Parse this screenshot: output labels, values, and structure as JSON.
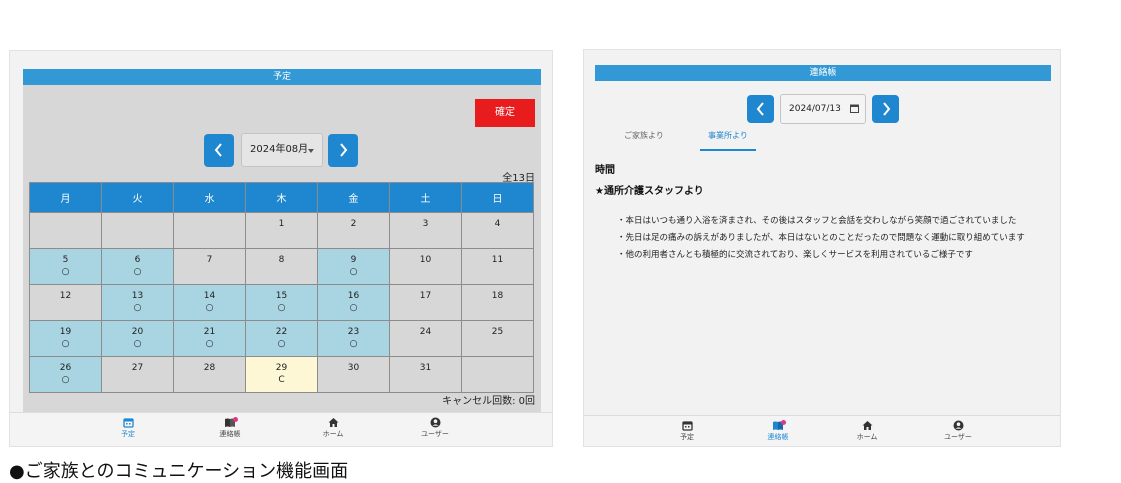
{
  "schedule": {
    "title": "予定",
    "confirm_label": "確定",
    "month_value": "2024年08月",
    "total_days": "全13日",
    "weekdays": [
      "月",
      "火",
      "水",
      "木",
      "金",
      "土",
      "日"
    ],
    "weeks": [
      [
        {
          "day": "",
          "mark": ""
        },
        {
          "day": "",
          "mark": ""
        },
        {
          "day": "",
          "mark": ""
        },
        {
          "day": "1",
          "mark": ""
        },
        {
          "day": "2",
          "mark": ""
        },
        {
          "day": "3",
          "mark": ""
        },
        {
          "day": "4",
          "mark": ""
        }
      ],
      [
        {
          "day": "5",
          "mark": "○"
        },
        {
          "day": "6",
          "mark": "○"
        },
        {
          "day": "7",
          "mark": ""
        },
        {
          "day": "8",
          "mark": ""
        },
        {
          "day": "9",
          "mark": "○"
        },
        {
          "day": "10",
          "mark": ""
        },
        {
          "day": "11",
          "mark": ""
        }
      ],
      [
        {
          "day": "12",
          "mark": ""
        },
        {
          "day": "13",
          "mark": "○"
        },
        {
          "day": "14",
          "mark": "○"
        },
        {
          "day": "15",
          "mark": "○"
        },
        {
          "day": "16",
          "mark": "○"
        },
        {
          "day": "17",
          "mark": ""
        },
        {
          "day": "18",
          "mark": ""
        }
      ],
      [
        {
          "day": "19",
          "mark": "○"
        },
        {
          "day": "20",
          "mark": "○"
        },
        {
          "day": "21",
          "mark": "○"
        },
        {
          "day": "22",
          "mark": "○"
        },
        {
          "day": "23",
          "mark": "○"
        },
        {
          "day": "24",
          "mark": ""
        },
        {
          "day": "25",
          "mark": ""
        }
      ],
      [
        {
          "day": "26",
          "mark": "○"
        },
        {
          "day": "27",
          "mark": ""
        },
        {
          "day": "28",
          "mark": ""
        },
        {
          "day": "29",
          "mark": "C"
        },
        {
          "day": "30",
          "mark": ""
        },
        {
          "day": "31",
          "mark": ""
        },
        {
          "day": "",
          "mark": ""
        }
      ]
    ],
    "cancel_count": "キャンセル回数: 0回"
  },
  "contact_book": {
    "title": "連絡帳",
    "date_value": "2024/07/13",
    "tabs": [
      {
        "label": "ご家族より",
        "active": false
      },
      {
        "label": "事業所より",
        "active": true
      }
    ],
    "section_time": "時間",
    "section_title": "★通所介護スタッフより",
    "notes": [
      "・本日はいつも通り入浴を済まされ、その後はスタッフと会話を交わしながら笑顔で過ごされていました",
      "・先日は足の痛みの訴えがありましたが、本日はないとのことだったので問題なく運動に取り組めています",
      "・他の利用者さんとも積極的に交流されており、楽しくサービスを利用されているご様子です"
    ]
  },
  "bottom_nav": {
    "items": [
      {
        "label": "予定",
        "icon": "calendar-icon"
      },
      {
        "label": "連絡帳",
        "icon": "book-icon"
      },
      {
        "label": "ホーム",
        "icon": "home-icon"
      },
      {
        "label": "ユーザー",
        "icon": "user-icon"
      }
    ]
  },
  "colors": {
    "header_blue": "#3399d6",
    "button_blue": "#1f87d0",
    "confirm_red": "#e81c1c",
    "booked_cell": "#a9d4e2",
    "today_cell": "#fdf7d6",
    "notification_dot": "#e0358d"
  },
  "caption": "●ご家族とのコミュニケーション機能画面"
}
